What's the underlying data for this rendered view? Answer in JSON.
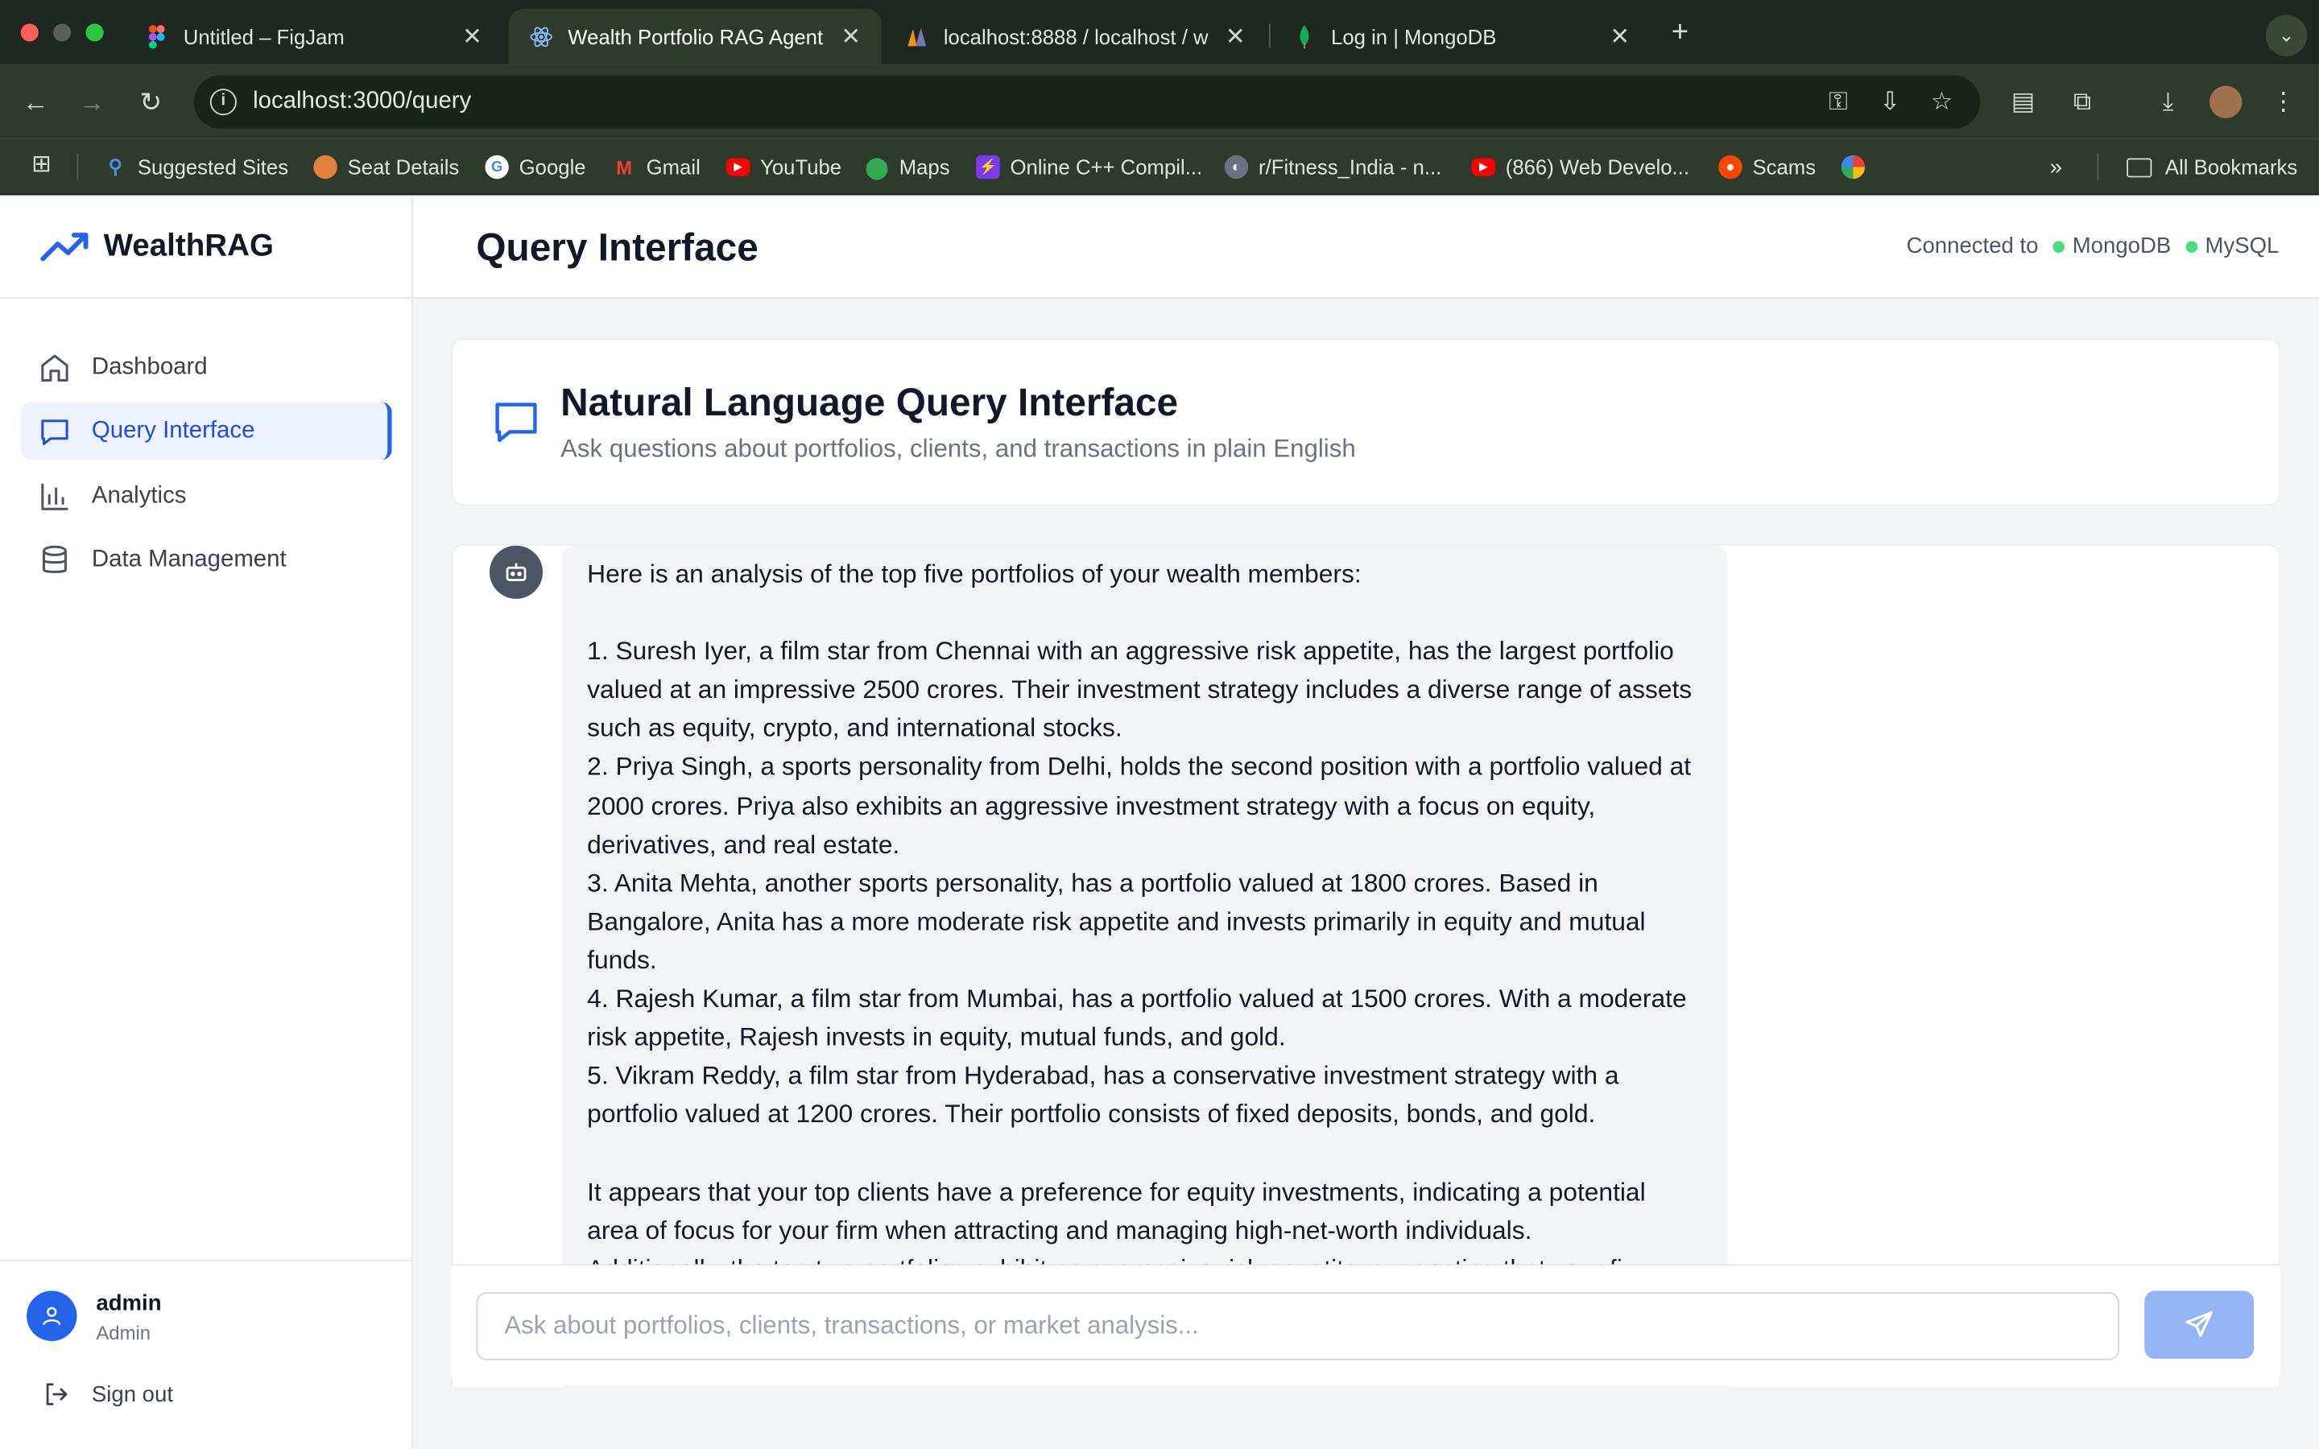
{
  "browser": {
    "tabs": [
      {
        "title": "Untitled – FigJam",
        "icon": "figma-icon"
      },
      {
        "title": "Wealth Portfolio RAG Agent",
        "icon": "react-icon"
      },
      {
        "title": "localhost:8888 / localhost / w",
        "icon": "phpmyadmin-icon"
      },
      {
        "title": "Log in | MongoDB",
        "icon": "mongodb-leaf-icon"
      }
    ],
    "url": "localhost:3000/query",
    "bookmarks": [
      {
        "label": "Suggested Sites",
        "color": "#4a90e2"
      },
      {
        "label": "Seat Details",
        "color": "#e0823d"
      },
      {
        "label": "Google",
        "color": "#ffffff"
      },
      {
        "label": "Gmail",
        "color": "#ea4335"
      },
      {
        "label": "YouTube",
        "color": "#ff0000"
      },
      {
        "label": "Maps",
        "color": "#34a853"
      },
      {
        "label": "Online C++ Compil...",
        "color": "#7c3aed"
      },
      {
        "label": "r/Fitness_India - n...",
        "color": "#9ca3af"
      },
      {
        "label": "(866) Web Develo...",
        "color": "#ff0000"
      },
      {
        "label": "Scams",
        "color": "#ff4500"
      }
    ],
    "all_bookmarks": "All Bookmarks"
  },
  "sidebar": {
    "brand": "WealthRAG",
    "items": [
      {
        "label": "Dashboard",
        "icon": "home-icon"
      },
      {
        "label": "Query Interface",
        "icon": "chat-icon"
      },
      {
        "label": "Analytics",
        "icon": "bar-chart-icon"
      },
      {
        "label": "Data Management",
        "icon": "database-icon"
      }
    ],
    "user": {
      "name": "admin",
      "role": "Admin"
    },
    "signout": "Sign out"
  },
  "header": {
    "title": "Query Interface",
    "connected_label": "Connected to",
    "db1": "MongoDB",
    "db2": "MySQL",
    "status_color": "#4ade80"
  },
  "card": {
    "title": "Natural Language Query Interface",
    "subtitle": "Ask questions about portfolios, clients, and transactions in plain English"
  },
  "message": {
    "intro": "Here is an analysis of the top five portfolios of your wealth members:",
    "p1": "1. Suresh Iyer, a film star from Chennai with an aggressive risk appetite, has the largest portfolio valued at an impressive 2500 crores. Their investment strategy includes a diverse range of assets such as equity, crypto, and international stocks.",
    "p2": "2. Priya Singh, a sports personality from Delhi, holds the second position with a portfolio valued at 2000 crores. Priya also exhibits an aggressive investment strategy with a focus on equity, derivatives, and real estate.",
    "p3": "3. Anita Mehta, another sports personality, has a portfolio valued at 1800 crores. Based in Bangalore, Anita has a more moderate risk appetite and invests primarily in equity and mutual funds.",
    "p4": "4. Rajesh Kumar, a film star from Mumbai, has a portfolio valued at 1500 crores. With a moderate risk appetite, Rajesh invests in equity, mutual funds, and gold.",
    "p5": "5. Vikram Reddy, a film star from Hyderabad, has a conservative investment strategy with a portfolio valued at 1200 crores. Their portfolio consists of fixed deposits, bonds, and gold.",
    "conclusion": "It appears that your top clients have a preference for equity investments, indicating a potential area of focus for your firm when attracting and managing high-net-worth individuals.",
    "cutoff": "Additionally, the top two portfolios exhibit an aggressive risk appetite, suggesting that your fi"
  },
  "input": {
    "placeholder": "Ask about portfolios, clients, transactions, or market analysis...",
    "value": "",
    "send_color": "#93b4f5"
  },
  "accent": "#2563eb"
}
